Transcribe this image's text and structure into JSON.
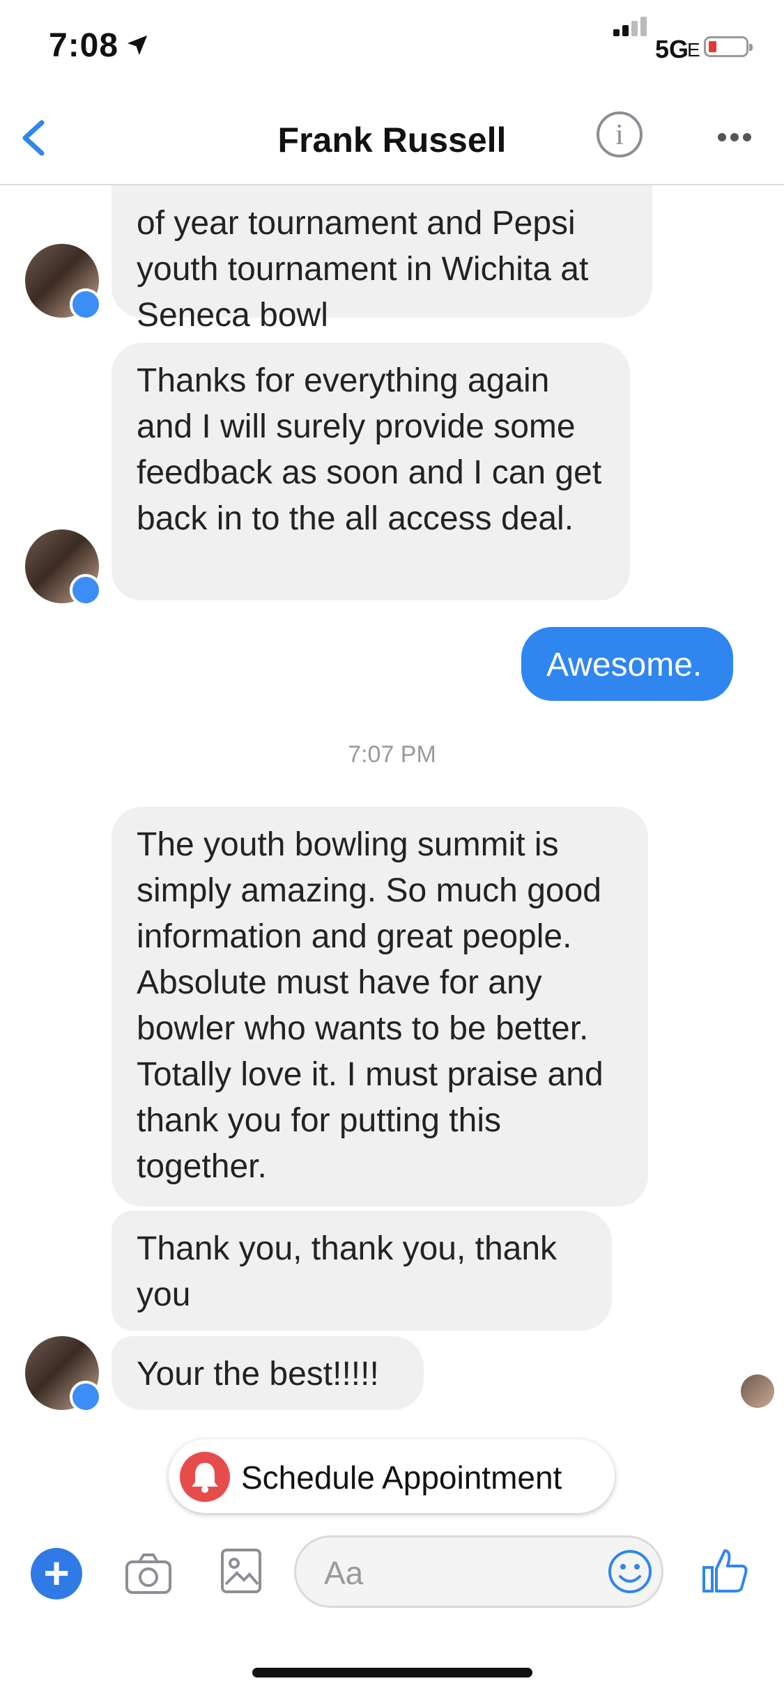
{
  "status_bar": {
    "time": "7:08",
    "network": "5G",
    "network_suffix": "E"
  },
  "header": {
    "contact_name": "Frank Russell"
  },
  "messages": [
    {
      "text": "of year tournament and Pepsi youth tournament in Wichita at Seneca bowl",
      "direction": "incoming"
    },
    {
      "text": "Thanks for everything again and I will surely provide some feedback as soon and I can get back in to the all access deal.",
      "direction": "incoming"
    },
    {
      "text": "Awesome.",
      "direction": "outgoing"
    },
    {
      "text": "The youth bowling summit is simply amazing. So much good information and great people. Absolute must have for any bowler who wants to be better. Totally love it. I must praise and thank you for putting this together.",
      "direction": "incoming"
    },
    {
      "text": "Thank you, thank you, thank you",
      "direction": "incoming"
    },
    {
      "text": "Your the best!!!!!",
      "direction": "incoming"
    }
  ],
  "timestamp": "7:07 PM",
  "quick_action": {
    "label": "Schedule Appointment"
  },
  "composer": {
    "placeholder": "Aa"
  },
  "colors": {
    "accent": "#2f86ee",
    "incoming_bubble": "#f0f0f0",
    "bell": "#e74c4c"
  }
}
